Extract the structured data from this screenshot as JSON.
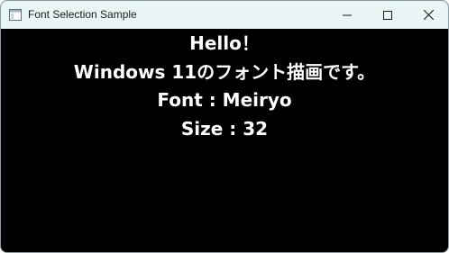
{
  "window": {
    "title": "Font Selection Sample"
  },
  "title_bar_buttons": {
    "minimize_icon": "minimize-icon",
    "maximize_icon": "maximize-icon",
    "close_icon": "close-icon"
  },
  "content": {
    "lines": [
      "Hello！",
      "Windows 11のフォント描画です。",
      "Font : Meiryo",
      "Size : 32"
    ]
  },
  "colors": {
    "titlebar_bg": "#e9f4f5",
    "client_bg": "#000000",
    "text": "#ffffff"
  }
}
